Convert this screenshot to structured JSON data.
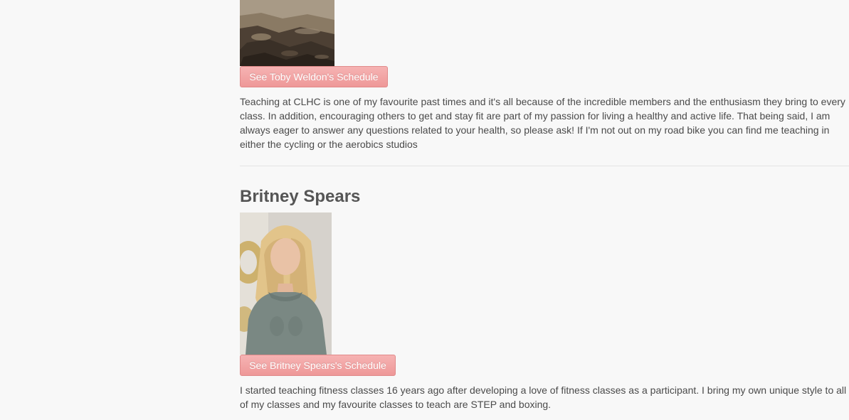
{
  "instructors": [
    {
      "name": "",
      "schedule_button": "See Toby Weldon's Schedule",
      "bio": "Teaching at CLHC is one of my favourite past times and it's all because of the incredible members and the enthusiasm they bring to every class. In addition, encouraging others to get and stay fit are part of my passion for living a healthy and active life. That being said, I am always eager to answer any questions related to your health, so please ask! If I'm not out on my road bike you can find me teaching in either the cycling or the aerobics studios"
    },
    {
      "name": "Britney Spears",
      "schedule_button": "See Britney Spears's Schedule",
      "bio": "I started teaching fitness classes 16 years ago after developing a love of fitness classes as a participant. I bring my own unique style to all of my classes and my favourite classes to teach are STEP and boxing."
    }
  ],
  "colors": {
    "button_bg": "#f0a3a3",
    "button_text": "#ffffff",
    "page_bg": "#f8f8f8",
    "text": "#4a4a4a",
    "heading": "#555555"
  }
}
